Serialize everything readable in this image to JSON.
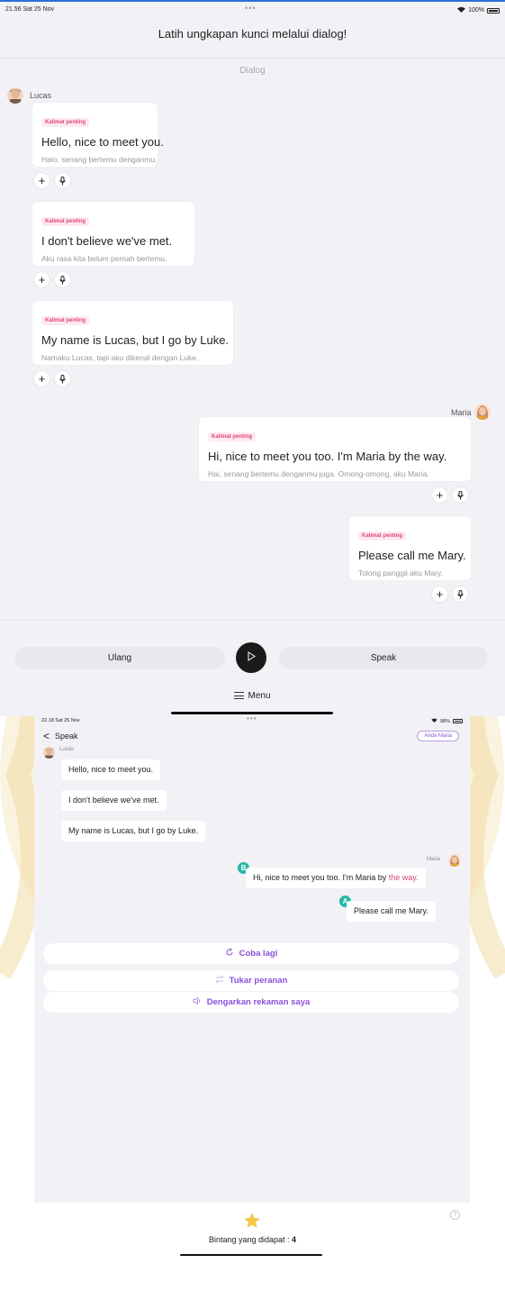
{
  "colors": {
    "accent_purple": "#8a4fd8",
    "highlight_pink": "#d0487a",
    "tag_pink": "#e0477a",
    "marker_teal": "#26b8a8",
    "play_black": "#1a1a1a",
    "star_yellow": "#f5c84b"
  },
  "screen1": {
    "status": {
      "time": "21.56  Sat 25 Nov",
      "battery": "100%"
    },
    "header_title": "Latih ungkapan kunci melalui dialog!",
    "section_label": "Dialog",
    "speaker_left": "Lucas",
    "speaker_right": "Maria",
    "messages": [
      {
        "tag": "Kalimat penting",
        "en": "Hello, nice to meet you.",
        "id": "Halo, senang bertemu denganmu."
      },
      {
        "tag": "Kalimat penting",
        "en": "I don't believe we've met.",
        "id": "Aku rasa kita belum pernah bertemu."
      },
      {
        "tag": "Kalimat penting",
        "en": "My name is Lucas, but I go by Luke.",
        "id": "Namaku Lucas, tapi aku dikenal dengan Luke."
      },
      {
        "tag": "Kalimat penting",
        "en": "Hi, nice to meet you too. I'm Maria by the way.",
        "id": "Hai, senang bertemu denganmu juga. Omong-omong, aku Maria."
      },
      {
        "tag": "Kalimat penting",
        "en": "Please call me Mary.",
        "id": "Tolong panggil aku Mary."
      }
    ],
    "icons": {
      "add": "plus-icon",
      "mic": "microphone-icon",
      "play": "play-icon",
      "menu": "hamburger-icon"
    },
    "plus_glyph": "+",
    "footer": {
      "repeat_label": "Ulang",
      "speak_label": "Speak",
      "menu_label": "Menu"
    }
  },
  "screen2": {
    "status": {
      "time": "22.18  Sat 25 Nov",
      "battery": "98%"
    },
    "back_chevron": "<",
    "back_label": "Speak",
    "role_badge": "Anda Maria",
    "speaker_left": "Lucas",
    "speaker_right": "Maria",
    "lucas_lines": [
      "Hello, nice to meet you.",
      "I don't believe we've met.",
      "My name is Lucas, but I go by Luke."
    ],
    "maria_line_1_main": "Hi, nice to meet you too. I'm Maria by ",
    "maria_line_1_highlight": "the way.",
    "maria_line_2": "Please call me Mary.",
    "markers": [
      "B",
      "A"
    ],
    "actions": {
      "retry": "Coba lagi",
      "switch_role": "Tukar peranan",
      "listen": "Dengarkan rekaman saya"
    },
    "icons": {
      "retry": "refresh-icon",
      "switch": "swap-icon",
      "listen": "speaker-icon",
      "help": "help-icon",
      "star": "star-icon"
    },
    "help_glyph": "?",
    "stars_label": "Bintang yang didapat : ",
    "stars_count": "4"
  }
}
